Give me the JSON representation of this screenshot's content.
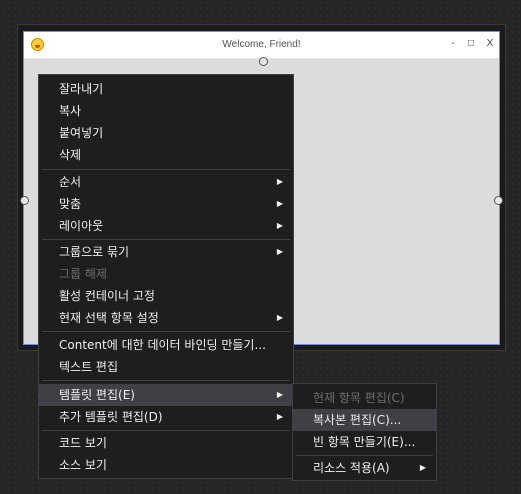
{
  "window": {
    "title": "Welcome, Friend!",
    "icon": "emoji-face-icon",
    "minimize_label": "-",
    "maximize_label": "□",
    "close_label": "X"
  },
  "context_menu": {
    "items": [
      {
        "label": "잘라내기",
        "enabled": true,
        "submenu": false
      },
      {
        "label": "복사",
        "enabled": true,
        "submenu": false
      },
      {
        "label": "붙여넣기",
        "enabled": true,
        "submenu": false
      },
      {
        "label": "삭제",
        "enabled": true,
        "submenu": false
      },
      {
        "label": "순서",
        "enabled": true,
        "submenu": true
      },
      {
        "label": "맞춤",
        "enabled": true,
        "submenu": true
      },
      {
        "label": "레이아웃",
        "enabled": true,
        "submenu": true
      },
      {
        "label": "그룹으로 묶기",
        "enabled": true,
        "submenu": true
      },
      {
        "label": "그룹 해제",
        "enabled": false,
        "submenu": false
      },
      {
        "label": "활성 컨테이너 고정",
        "enabled": true,
        "submenu": false
      },
      {
        "label": "현재 선택 항목 설정",
        "enabled": true,
        "submenu": true
      },
      {
        "label": "Content에 대한 데이터 바인딩 만들기...",
        "enabled": true,
        "submenu": false
      },
      {
        "label": "텍스트 편집",
        "enabled": true,
        "submenu": false
      },
      {
        "label": "템플릿 편집(E)",
        "enabled": true,
        "submenu": true,
        "highlighted": true
      },
      {
        "label": "추가 템플릿 편집(D)",
        "enabled": true,
        "submenu": true
      },
      {
        "label": "코드 보기",
        "enabled": true,
        "submenu": false
      },
      {
        "label": "소스 보기",
        "enabled": true,
        "submenu": false
      }
    ],
    "submenu_arrow": "▶"
  },
  "submenu": {
    "items": [
      {
        "label": "현재 항목 편집(C)",
        "enabled": false,
        "submenu": false
      },
      {
        "label": "복사본 편집(C)...",
        "enabled": true,
        "submenu": false,
        "highlighted": true
      },
      {
        "label": "빈 항목 만들기(E)...",
        "enabled": true,
        "submenu": false
      },
      {
        "label": "리소스 적용(A)",
        "enabled": true,
        "submenu": true
      }
    ]
  }
}
